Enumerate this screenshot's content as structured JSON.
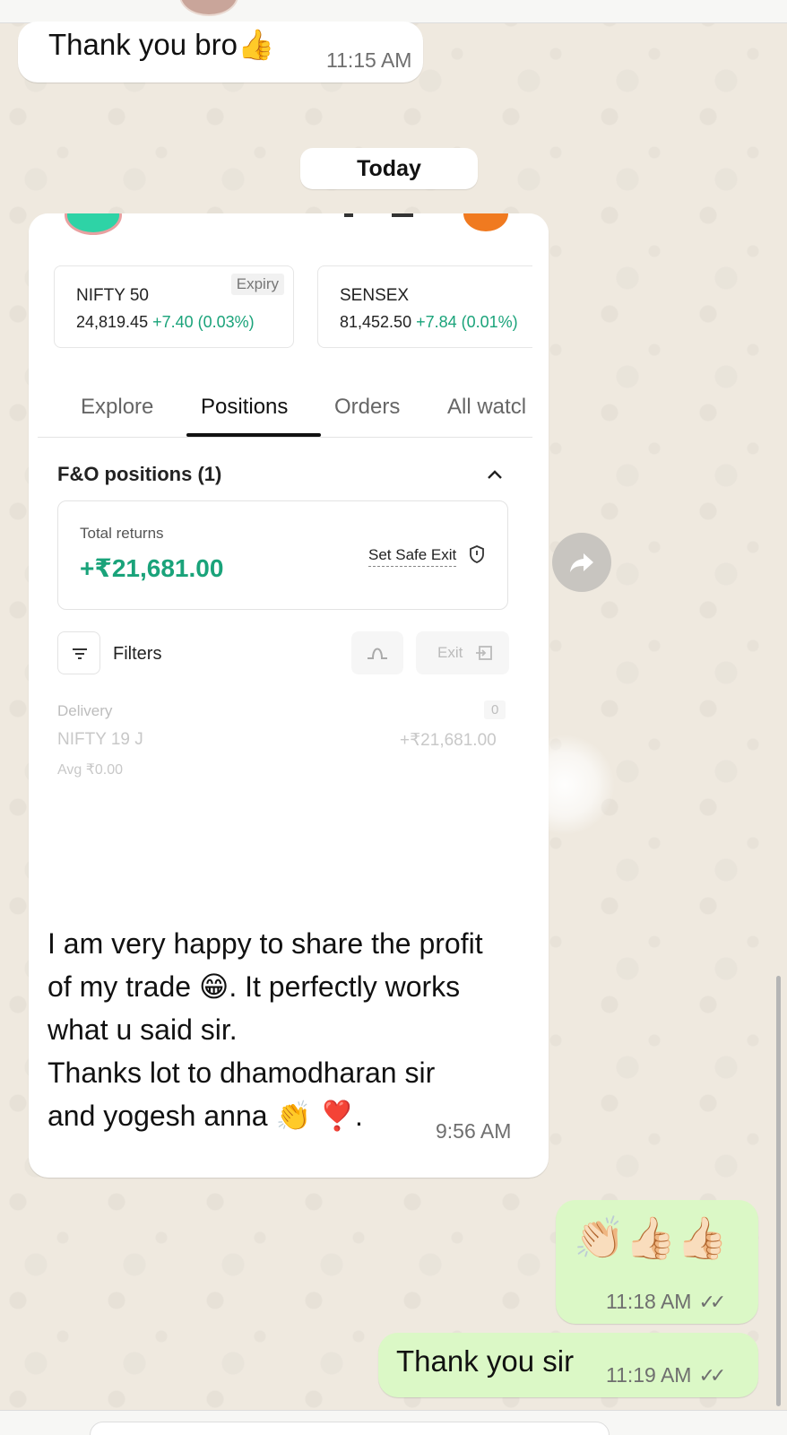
{
  "messages": {
    "m1": {
      "text": "Thank you bro👍",
      "time": "11:15 AM"
    },
    "date_divider": "Today",
    "image_message": {
      "screenshot": {
        "indices": [
          {
            "name": "NIFTY 50",
            "value": "24,819.45",
            "change": "+7.40 (0.03%)",
            "tag": "Expiry"
          },
          {
            "name": "SENSEX",
            "value": "81,452.50",
            "change": "+7.84 (0.01%)"
          }
        ],
        "tabs": [
          "Explore",
          "Positions",
          "Orders",
          "All watcl"
        ],
        "active_tab": "Positions",
        "section_title": "F&O positions (1)",
        "total_returns_label": "Total returns",
        "total_returns_value": "+₹21,681.00",
        "safe_exit_label": "Set Safe Exit",
        "filters_label": "Filters",
        "exit_label": "Exit",
        "position": {
          "type": "Delivery",
          "qty": "0",
          "name": "NIFTY 19 J",
          "pnl": "+₹21,681.00",
          "avg": "Avg ₹0.00"
        }
      },
      "caption_lines": [
        "I am very happy to share the profit",
        "of my trade 😁. It perfectly works",
        "what u said sir.",
        "Thanks lot to dhamodharan sir",
        "and yogesh anna 👏 ❣️."
      ],
      "time": "9:56 AM"
    },
    "m3": {
      "text": "👏🏻👍🏻👍🏻",
      "time": "11:18 AM"
    },
    "m4": {
      "text": "Thank you sir",
      "time": "11:19 AM"
    }
  },
  "icons": {
    "forward": "forward-share-icon",
    "ticks": "double-check-icon"
  },
  "colors": {
    "chat_bg": "#efe9df",
    "incoming_bubble": "#ffffff",
    "outgoing_bubble": "#dbf8c6",
    "profit_green": "#1aa37a"
  }
}
